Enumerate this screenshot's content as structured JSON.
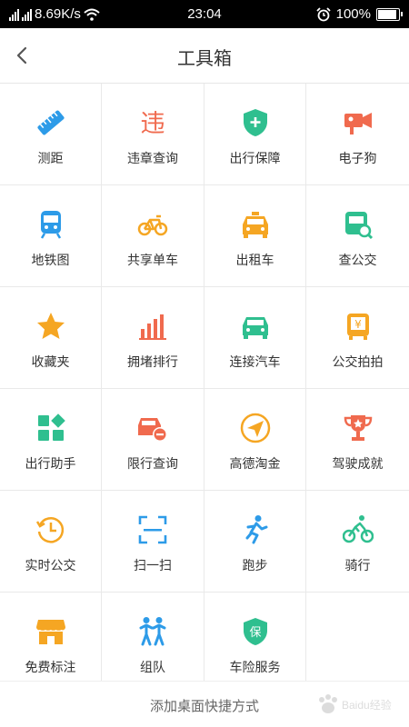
{
  "status_bar": {
    "network_speed": "8.69K/s",
    "time": "23:04",
    "battery": "100%",
    "battery_level": 1.0
  },
  "header": {
    "title": "工具箱"
  },
  "tools": [
    {
      "label": "测距",
      "icon": "ruler-icon"
    },
    {
      "label": "违章查询",
      "icon": "violation-icon"
    },
    {
      "label": "出行保障",
      "icon": "shield-plus-icon"
    },
    {
      "label": "电子狗",
      "icon": "camera-icon"
    },
    {
      "label": "地铁图",
      "icon": "subway-icon"
    },
    {
      "label": "共享单车",
      "icon": "bicycle-icon"
    },
    {
      "label": "出租车",
      "icon": "taxi-icon"
    },
    {
      "label": "查公交",
      "icon": "bus-search-icon"
    },
    {
      "label": "收藏夹",
      "icon": "star-icon"
    },
    {
      "label": "拥堵排行",
      "icon": "bar-chart-icon"
    },
    {
      "label": "连接汽车",
      "icon": "car-icon"
    },
    {
      "label": "公交拍拍",
      "icon": "bus-yen-icon"
    },
    {
      "label": "出行助手",
      "icon": "apps-icon"
    },
    {
      "label": "限行查询",
      "icon": "car-restrict-icon"
    },
    {
      "label": "高德淘金",
      "icon": "paper-plane-icon"
    },
    {
      "label": "驾驶成就",
      "icon": "trophy-icon"
    },
    {
      "label": "实时公交",
      "icon": "clock-icon"
    },
    {
      "label": "扫一扫",
      "icon": "scan-icon"
    },
    {
      "label": "跑步",
      "icon": "runner-icon"
    },
    {
      "label": "骑行",
      "icon": "cyclist-icon"
    },
    {
      "label": "免费标注",
      "icon": "shop-icon"
    },
    {
      "label": "组队",
      "icon": "team-icon"
    },
    {
      "label": "车险服务",
      "icon": "insurance-icon"
    },
    {
      "label": "",
      "icon": ""
    }
  ],
  "icon_glyphs": {
    "violation": "违",
    "insurance": "保",
    "yen": "¥"
  },
  "colors": {
    "blue": "#2d9be8",
    "orange": "#f5a623",
    "red": "#f06a4e",
    "green": "#2fbf8f"
  },
  "footer": {
    "add_shortcut": "添加桌面快捷方式"
  },
  "watermark": "Baidu经验"
}
